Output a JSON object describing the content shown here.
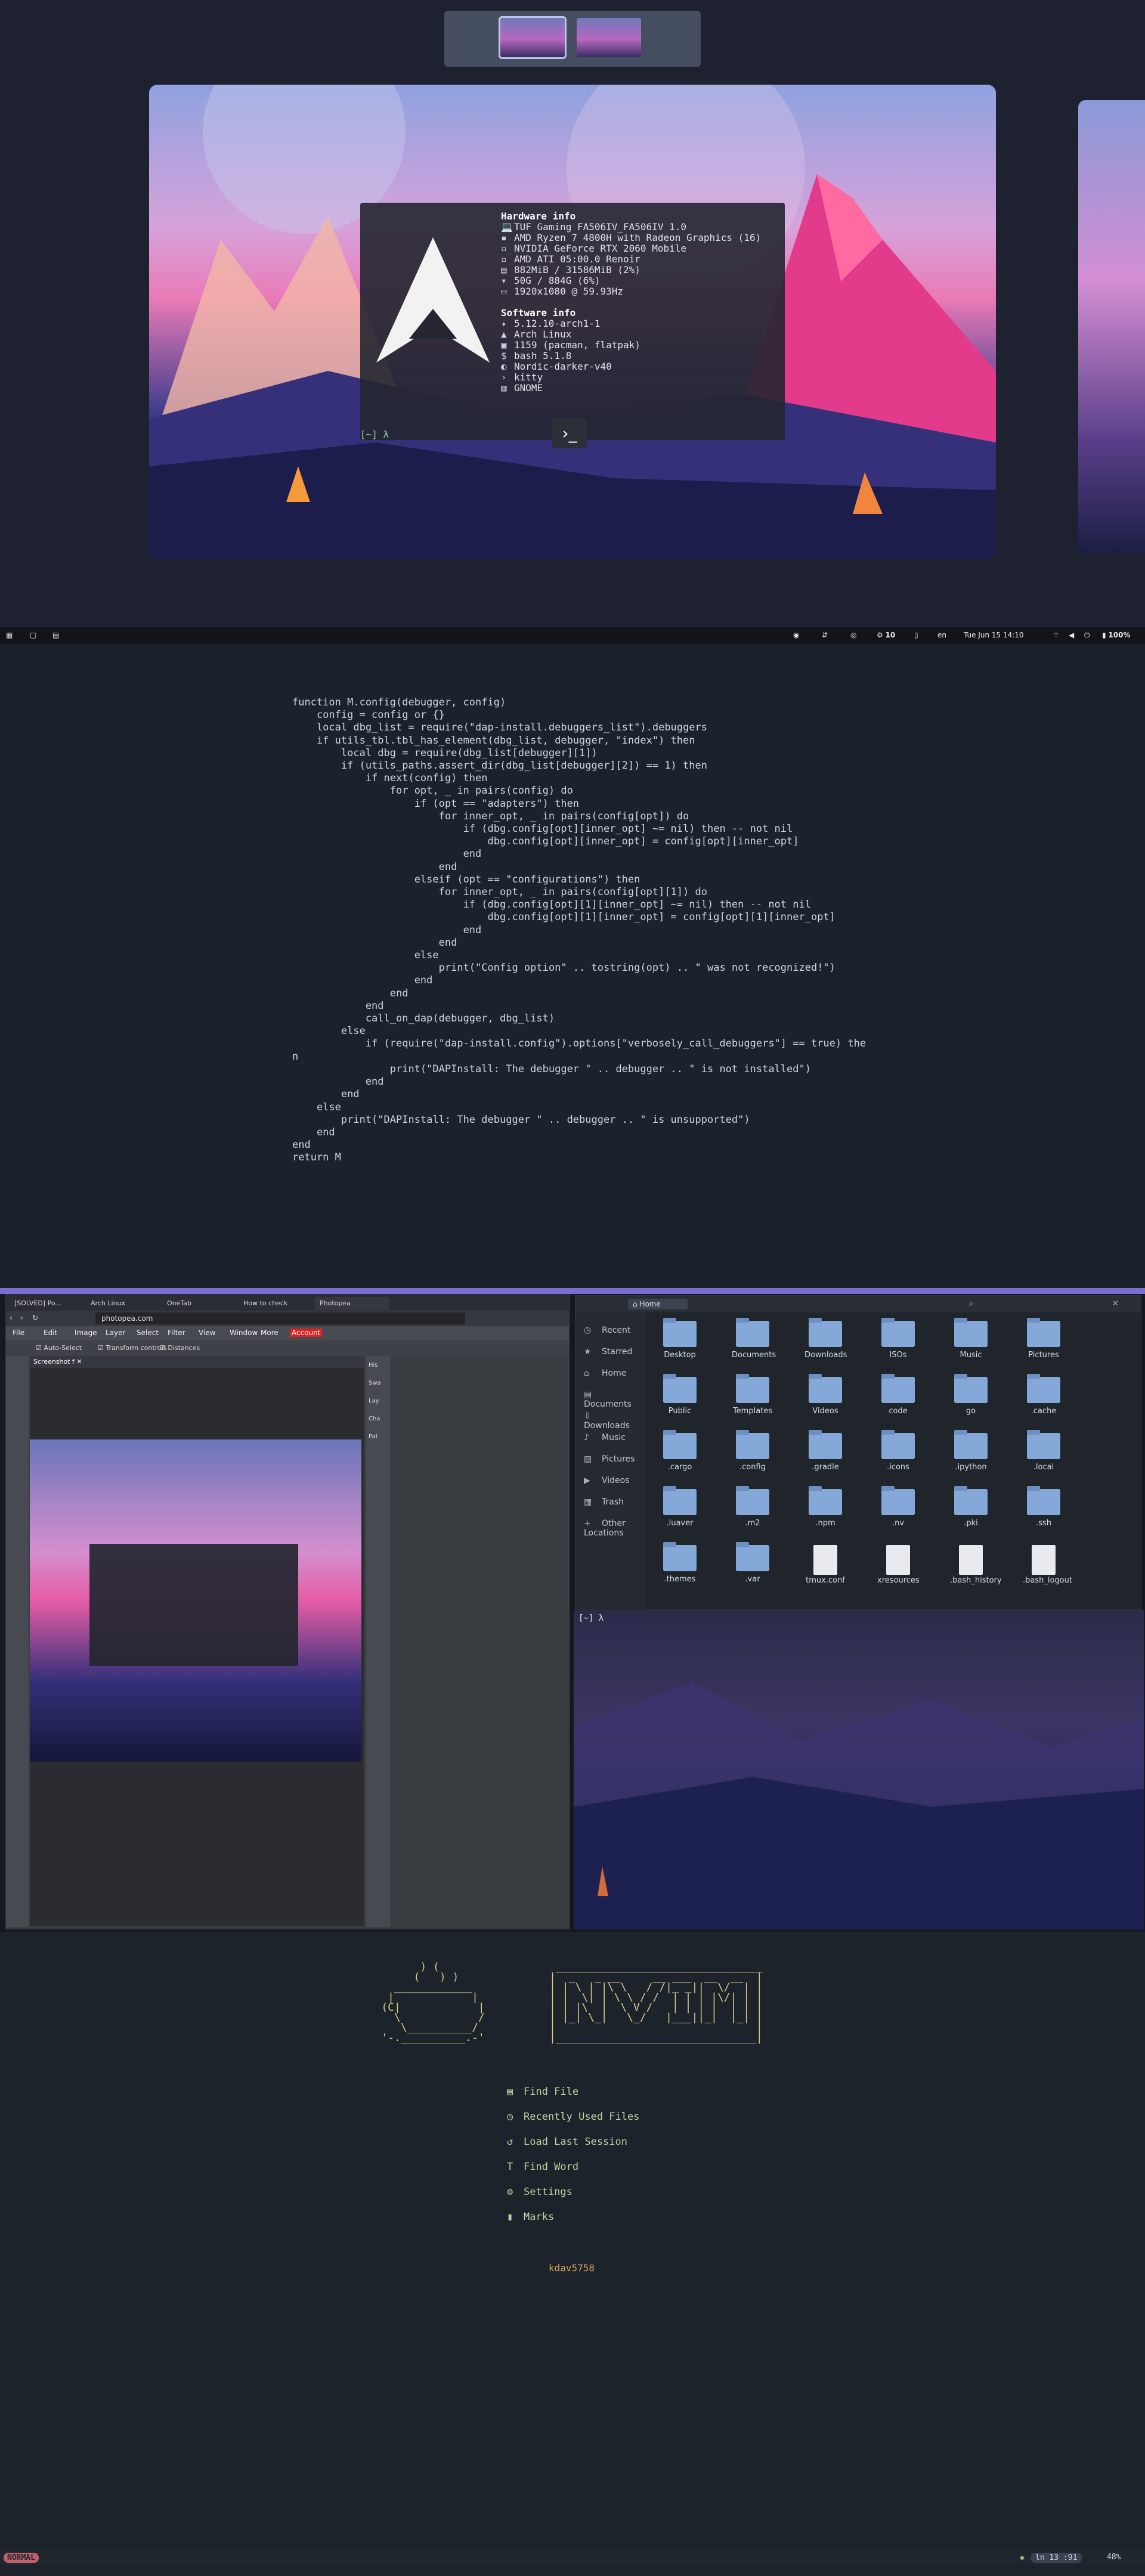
{
  "panel1": {
    "workspaces": [
      "workspace-1",
      "workspace-2"
    ],
    "fetch": {
      "hardware_title": "Hardware info",
      "hardware": [
        {
          "icon": "laptop-icon",
          "text": "TUF Gaming FA506IV_FA506IV 1.0"
        },
        {
          "icon": "cpu-icon",
          "text": "AMD Ryzen 7 4800H with Radeon Graphics (16)"
        },
        {
          "icon": "gpu-icon",
          "text": "NVIDIA GeForce RTX 2060 Mobile"
        },
        {
          "icon": "gpu-icon",
          "text": "AMD ATI 05:00.0 Renoir"
        },
        {
          "icon": "memory-icon",
          "text": "882MiB / 31586MiB (2%)"
        },
        {
          "icon": "disk-icon",
          "text": "50G / 884G (6%)"
        },
        {
          "icon": "display-icon",
          "text": "1920x1080 @ 59.93Hz"
        }
      ],
      "software_title": "Software info",
      "software": [
        {
          "icon": "kernel-icon",
          "text": "5.12.10-arch1-1"
        },
        {
          "icon": "arch-icon",
          "text": "Arch Linux"
        },
        {
          "icon": "package-icon",
          "text": "1159 (pacman, flatpak)"
        },
        {
          "icon": "shell-icon",
          "text": "bash 5.1.8"
        },
        {
          "icon": "theme-icon",
          "text": "Nordic-darker-v40"
        },
        {
          "icon": "terminal-icon",
          "text": "kitty"
        },
        {
          "icon": "desktop-icon",
          "text": "GNOME"
        }
      ],
      "prompt": "[~] λ"
    },
    "topbar": {
      "workspace_num": "10",
      "lang": "en",
      "datetime": "Tue Jun 15 14:10",
      "battery": "100%"
    }
  },
  "panel2": {
    "code_lines": [
      "function M.config(debugger, config)",
      "    config = config or {}",
      "    local dbg_list = require(\"dap-install.debuggers_list\").debuggers",
      "",
      "    if utils_tbl.tbl_has_element(dbg_list, debugger, \"index\") then",
      "        local dbg = require(dbg_list[debugger][1])",
      "",
      "        if (utils_paths.assert_dir(dbg_list[debugger][2]) == 1) then",
      "            if next(config) then",
      "                for opt, _ in pairs(config) do",
      "                    if (opt == \"adapters\") then",
      "                        for inner_opt, _ in pairs(config[opt]) do",
      "                            if (dbg.config[opt][inner_opt] ~= nil) then -- not nil",
      "                                dbg.config[opt][inner_opt] = config[opt][inner_opt]",
      "                            end",
      "                        end",
      "                    elseif (opt == \"configurations\") then",
      "                        for inner_opt, _ in pairs(config[opt][1]) do",
      "                            if (dbg.config[opt][1][inner_opt] ~= nil) then -- not nil",
      "                                dbg.config[opt][1][inner_opt] = config[opt][1][inner_opt]",
      "                            end",
      "                        end",
      "                    else",
      "                        print(\"Config option\" .. tostring(opt) .. \" was not recognized!\")",
      "                    end",
      "                end",
      "            end",
      "",
      "            call_on_dap(debugger, dbg_list)",
      "        else",
      "            if (require(\"dap-install.config\").options[\"verbosely_call_debuggers\"] == true) the",
      "n",
      "                print(\"DAPInstall: The debugger \" .. debugger .. \" is not installed\")",
      "            end",
      "        end",
      "    else",
      "        print(\"DAPInstall: The debugger \" .. debugger .. \" is unsupported\")",
      "    end",
      "end",
      "",
      "return M"
    ]
  },
  "panel3": {
    "browser": {
      "tabs": [
        "[SOLVED] Po...",
        "Arch Linux",
        "OneTab",
        "How to check",
        "Photopea"
      ],
      "url": "photopea.com",
      "menu": [
        "File",
        "Edit",
        "Image",
        "Layer",
        "Select",
        "Filter",
        "View",
        "Window",
        "More",
        "Account"
      ],
      "options": [
        "Auto-Select",
        "Transform controls",
        "Distances"
      ],
      "doc_tab": "Screenshot f",
      "right_panel": [
        "His",
        "Swa",
        "Lay",
        "Cha",
        "Pat"
      ]
    },
    "files": {
      "path": "Home",
      "sidebar": [
        {
          "icon": "recent-icon",
          "label": "Recent"
        },
        {
          "icon": "star-icon",
          "label": "Starred"
        },
        {
          "icon": "home-icon",
          "label": "Home"
        },
        {
          "icon": "document-icon",
          "label": "Documents"
        },
        {
          "icon": "download-icon",
          "label": "Downloads"
        },
        {
          "icon": "music-icon",
          "label": "Music"
        },
        {
          "icon": "picture-icon",
          "label": "Pictures"
        },
        {
          "icon": "video-icon",
          "label": "Videos"
        },
        {
          "icon": "trash-icon",
          "label": "Trash"
        },
        {
          "icon": "plus-icon",
          "label": "Other Locations"
        }
      ],
      "items": [
        "Desktop",
        "Documents",
        "Downloads",
        "ISOs",
        "Music",
        "Pictures",
        "Public",
        "Templates",
        "Videos",
        "code",
        "go",
        ".cache",
        ".cargo",
        ".config",
        ".gradle",
        ".icons",
        ".ipython",
        ".local",
        ".luaver",
        ".m2",
        ".npm",
        ".nv",
        ".pki",
        ".ssh",
        ".themes",
        ".var",
        "tmux.conf",
        "xresources",
        ".bash_history",
        ".bash_logout"
      ],
      "file_types": {
        "tmux.conf": "doc",
        "xresources": "doc",
        ".bash_history": "doc",
        ".bash_logout": "doc"
      }
    },
    "terminal_prompt": "[~] λ"
  },
  "panel4": {
    "menu": [
      {
        "icon": "file-icon",
        "label": "Find File"
      },
      {
        "icon": "clock-icon",
        "label": "Recently Used Files"
      },
      {
        "icon": "restore-icon",
        "label": "Load Last Session"
      },
      {
        "icon": "text-icon",
        "label": "Find Word"
      },
      {
        "icon": "gear-icon",
        "label": "Settings"
      },
      {
        "icon": "bookmark-icon",
        "label": "Marks"
      }
    ],
    "user": "kdav5758",
    "status": {
      "mode": "NORMAL",
      "position": "ln 13 :91",
      "percent": "48%"
    }
  }
}
